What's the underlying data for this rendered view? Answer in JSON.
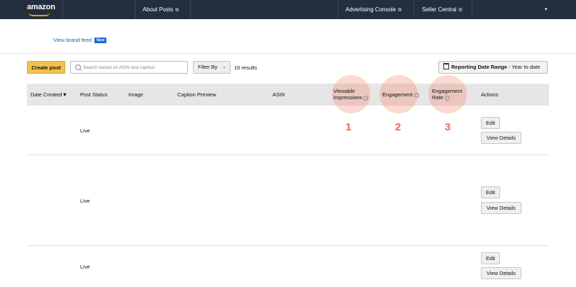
{
  "nav": {
    "logo": "amazon",
    "about_posts": "About Posts",
    "advertising_console": "Advertising Console",
    "seller_central": "Seller Central",
    "external_icon": "⧉",
    "menu_caret": "▾"
  },
  "brand_feed": {
    "label": "View brand feed",
    "badge": "New"
  },
  "toolbar": {
    "create_post": "Create post",
    "search_placeholder": "Search based on ASIN and caption",
    "filter_by": "Filter By",
    "filter_chevron": "⌄",
    "results": "15 results",
    "date_range_label": "Reporting Date Range",
    "date_range_value": " - Year to date"
  },
  "table": {
    "headers": {
      "date_created": "Date Created",
      "sort_icon": "▼",
      "post_status": "Post Status",
      "image": "Image",
      "caption_preview": "Caption Preview",
      "asin": "ASIN",
      "viewable_1": "Viewable",
      "viewable_2": "Impressions",
      "engagement": "Engagement",
      "engagement_rate_1": "Engagement",
      "engagement_rate_2": "Rate",
      "actions": "Actions",
      "info_icon": "i"
    },
    "rows": [
      {
        "status": "Live",
        "edit": "Edit",
        "view": "View Details"
      },
      {
        "status": "Live",
        "edit": "Edit",
        "view": "View Details"
      },
      {
        "status": "Live",
        "edit": "Edit",
        "view": "View Details"
      }
    ]
  },
  "annotations": [
    "1",
    "2",
    "3"
  ],
  "colors": {
    "nav_bg": "#232f3e",
    "create_btn": "#f0c14b",
    "annotation": "#ec6a4d",
    "link": "#1a5fa8"
  }
}
